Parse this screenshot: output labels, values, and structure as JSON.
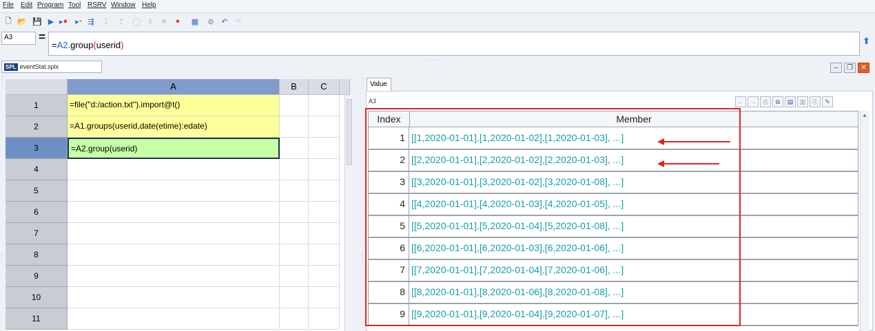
{
  "menu": [
    "File",
    "Edit",
    "Program",
    "Tool",
    "RSRV",
    "Window",
    "Help"
  ],
  "toolbar_icons": [
    "new-file",
    "open-folder",
    "save",
    "run",
    "run-to-cursor",
    "step",
    "debug-step",
    "step-into",
    "step-out",
    "pause",
    "stop",
    "breakpoint",
    "grid-view",
    "clear",
    "undo",
    "redo"
  ],
  "formula_bar": {
    "cell_name": "A3",
    "equals": "=",
    "formula_prefix": "=",
    "formula_ref": "A2",
    "formula_func": ".group",
    "formula_open": "(",
    "formula_arg": "userid",
    "formula_close": ")"
  },
  "split_handle": ".....",
  "file_tab": {
    "badge": "SPL",
    "name": "eventStat.splx"
  },
  "window_buttons": [
    "minimize",
    "restore",
    "close"
  ],
  "grid": {
    "columns": [
      "A",
      "B",
      "C"
    ],
    "rows": [
      {
        "num": "1",
        "a": "=file(\"d:/action.txt\").import@t()",
        "style": "yellow"
      },
      {
        "num": "2",
        "a": "=A1.groups(userid,date(etime):edate)",
        "style": "yellow"
      },
      {
        "num": "3",
        "a": "=A2.group(userid)",
        "style": "green"
      },
      {
        "num": "4",
        "a": "",
        "style": ""
      },
      {
        "num": "5",
        "a": "",
        "style": ""
      },
      {
        "num": "6",
        "a": "",
        "style": ""
      },
      {
        "num": "7",
        "a": "",
        "style": ""
      },
      {
        "num": "8",
        "a": "",
        "style": ""
      },
      {
        "num": "9",
        "a": "",
        "style": ""
      },
      {
        "num": "10",
        "a": "",
        "style": ""
      },
      {
        "num": "11",
        "a": "",
        "style": ""
      }
    ]
  },
  "value_panel": {
    "tab": "Value",
    "cell": "A3",
    "headers": [
      "Index",
      "Member"
    ],
    "rows": [
      {
        "index": "1",
        "member": "[[1,2020-01-01],[1,2020-01-02],[1,2020-01-03], ...]"
      },
      {
        "index": "2",
        "member": "[[2,2020-01-01],[2,2020-01-02],[2,2020-01-03], ...]"
      },
      {
        "index": "3",
        "member": "[[3,2020-01-01],[3,2020-01-02],[3,2020-01-08], ...]"
      },
      {
        "index": "4",
        "member": "[[4,2020-01-01],[4,2020-01-03],[4,2020-01-05], ...]"
      },
      {
        "index": "5",
        "member": "[[5,2020-01-01],[5,2020-01-04],[5,2020-01-08], ...]"
      },
      {
        "index": "6",
        "member": "[[6,2020-01-01],[6,2020-01-03],[6,2020-01-06], ...]"
      },
      {
        "index": "7",
        "member": "[[7,2020-01-01],[7,2020-01-04],[7,2020-01-06], ...]"
      },
      {
        "index": "8",
        "member": "[[8,2020-01-01],[8,2020-01-06],[8,2020-01-08], ...]"
      },
      {
        "index": "9",
        "member": "[[9,2020-01-01],[9,2020-01-04],[9,2020-01-07], ...]"
      }
    ]
  },
  "colors": {
    "selected_cell": "#c6ffa6",
    "formula_cell": "#ffff9a",
    "member_text": "#13a0a7",
    "highlight": "#e32222"
  }
}
